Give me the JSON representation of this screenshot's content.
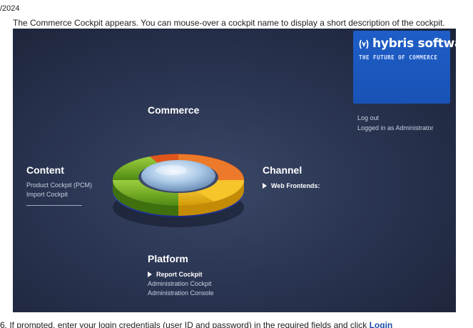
{
  "header": {
    "date_fragment": "/2024",
    "intro": "The Commerce Cockpit appears. You can mouse-over a cockpit name to display a short description of the cockpit."
  },
  "brand": {
    "name": "hybris software",
    "tagline": "THE FUTURE OF COMMERCE",
    "color": "#1f5ec7"
  },
  "session": {
    "logout_label": "Log out",
    "logged_in_text": "Logged in as Administrator"
  },
  "groups": {
    "commerce": {
      "title": "Commerce"
    },
    "content": {
      "title": "Content",
      "items": [
        "Product Cockpit (PCM)",
        "Import Cockpit"
      ]
    },
    "channel": {
      "title": "Channel",
      "items": [
        "Web Frontends:"
      ]
    },
    "platform": {
      "title": "Platform",
      "items": [
        "Report Cockpit",
        "Administration Cockpit",
        "Administration Console"
      ]
    }
  },
  "wheel": {
    "segments": [
      {
        "name": "content",
        "color": "#6aa51e"
      },
      {
        "name": "commerce",
        "color": "#e0561a"
      },
      {
        "name": "channel",
        "color": "#e9b514"
      },
      {
        "name": "platform",
        "color": "#2a45b8"
      }
    ]
  },
  "footer": {
    "prefix": "6. If prompted, enter your login credentials (user ID and password) in the required fields and click ",
    "link_label": "Login"
  }
}
